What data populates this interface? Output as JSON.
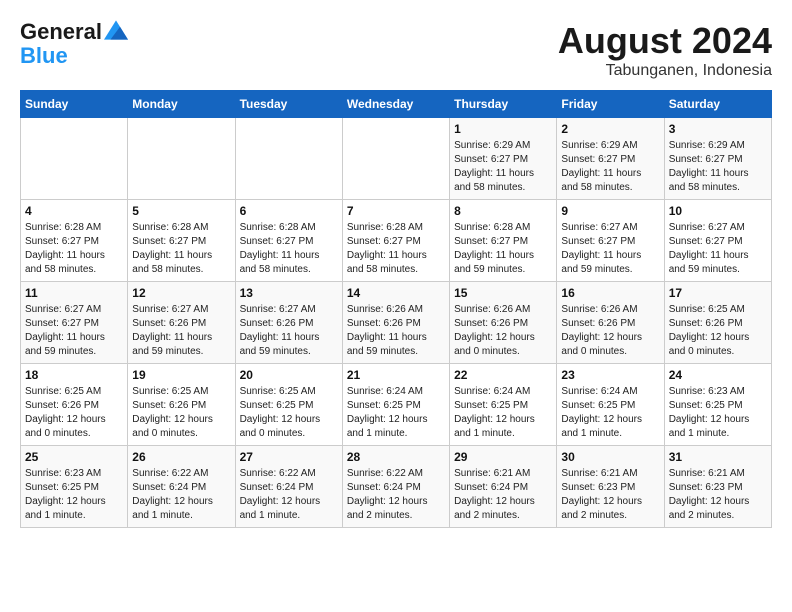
{
  "header": {
    "logo_line1": "General",
    "logo_line2": "Blue",
    "month": "August 2024",
    "location": "Tabunganen, Indonesia"
  },
  "weekdays": [
    "Sunday",
    "Monday",
    "Tuesday",
    "Wednesday",
    "Thursday",
    "Friday",
    "Saturday"
  ],
  "weeks": [
    [
      {
        "day": "",
        "info": ""
      },
      {
        "day": "",
        "info": ""
      },
      {
        "day": "",
        "info": ""
      },
      {
        "day": "",
        "info": ""
      },
      {
        "day": "1",
        "info": "Sunrise: 6:29 AM\nSunset: 6:27 PM\nDaylight: 11 hours\nand 58 minutes."
      },
      {
        "day": "2",
        "info": "Sunrise: 6:29 AM\nSunset: 6:27 PM\nDaylight: 11 hours\nand 58 minutes."
      },
      {
        "day": "3",
        "info": "Sunrise: 6:29 AM\nSunset: 6:27 PM\nDaylight: 11 hours\nand 58 minutes."
      }
    ],
    [
      {
        "day": "4",
        "info": "Sunrise: 6:28 AM\nSunset: 6:27 PM\nDaylight: 11 hours\nand 58 minutes."
      },
      {
        "day": "5",
        "info": "Sunrise: 6:28 AM\nSunset: 6:27 PM\nDaylight: 11 hours\nand 58 minutes."
      },
      {
        "day": "6",
        "info": "Sunrise: 6:28 AM\nSunset: 6:27 PM\nDaylight: 11 hours\nand 58 minutes."
      },
      {
        "day": "7",
        "info": "Sunrise: 6:28 AM\nSunset: 6:27 PM\nDaylight: 11 hours\nand 58 minutes."
      },
      {
        "day": "8",
        "info": "Sunrise: 6:28 AM\nSunset: 6:27 PM\nDaylight: 11 hours\nand 59 minutes."
      },
      {
        "day": "9",
        "info": "Sunrise: 6:27 AM\nSunset: 6:27 PM\nDaylight: 11 hours\nand 59 minutes."
      },
      {
        "day": "10",
        "info": "Sunrise: 6:27 AM\nSunset: 6:27 PM\nDaylight: 11 hours\nand 59 minutes."
      }
    ],
    [
      {
        "day": "11",
        "info": "Sunrise: 6:27 AM\nSunset: 6:27 PM\nDaylight: 11 hours\nand 59 minutes."
      },
      {
        "day": "12",
        "info": "Sunrise: 6:27 AM\nSunset: 6:26 PM\nDaylight: 11 hours\nand 59 minutes."
      },
      {
        "day": "13",
        "info": "Sunrise: 6:27 AM\nSunset: 6:26 PM\nDaylight: 11 hours\nand 59 minutes."
      },
      {
        "day": "14",
        "info": "Sunrise: 6:26 AM\nSunset: 6:26 PM\nDaylight: 11 hours\nand 59 minutes."
      },
      {
        "day": "15",
        "info": "Sunrise: 6:26 AM\nSunset: 6:26 PM\nDaylight: 12 hours\nand 0 minutes."
      },
      {
        "day": "16",
        "info": "Sunrise: 6:26 AM\nSunset: 6:26 PM\nDaylight: 12 hours\nand 0 minutes."
      },
      {
        "day": "17",
        "info": "Sunrise: 6:25 AM\nSunset: 6:26 PM\nDaylight: 12 hours\nand 0 minutes."
      }
    ],
    [
      {
        "day": "18",
        "info": "Sunrise: 6:25 AM\nSunset: 6:26 PM\nDaylight: 12 hours\nand 0 minutes."
      },
      {
        "day": "19",
        "info": "Sunrise: 6:25 AM\nSunset: 6:26 PM\nDaylight: 12 hours\nand 0 minutes."
      },
      {
        "day": "20",
        "info": "Sunrise: 6:25 AM\nSunset: 6:25 PM\nDaylight: 12 hours\nand 0 minutes."
      },
      {
        "day": "21",
        "info": "Sunrise: 6:24 AM\nSunset: 6:25 PM\nDaylight: 12 hours\nand 1 minute."
      },
      {
        "day": "22",
        "info": "Sunrise: 6:24 AM\nSunset: 6:25 PM\nDaylight: 12 hours\nand 1 minute."
      },
      {
        "day": "23",
        "info": "Sunrise: 6:24 AM\nSunset: 6:25 PM\nDaylight: 12 hours\nand 1 minute."
      },
      {
        "day": "24",
        "info": "Sunrise: 6:23 AM\nSunset: 6:25 PM\nDaylight: 12 hours\nand 1 minute."
      }
    ],
    [
      {
        "day": "25",
        "info": "Sunrise: 6:23 AM\nSunset: 6:25 PM\nDaylight: 12 hours\nand 1 minute."
      },
      {
        "day": "26",
        "info": "Sunrise: 6:22 AM\nSunset: 6:24 PM\nDaylight: 12 hours\nand 1 minute."
      },
      {
        "day": "27",
        "info": "Sunrise: 6:22 AM\nSunset: 6:24 PM\nDaylight: 12 hours\nand 1 minute."
      },
      {
        "day": "28",
        "info": "Sunrise: 6:22 AM\nSunset: 6:24 PM\nDaylight: 12 hours\nand 2 minutes."
      },
      {
        "day": "29",
        "info": "Sunrise: 6:21 AM\nSunset: 6:24 PM\nDaylight: 12 hours\nand 2 minutes."
      },
      {
        "day": "30",
        "info": "Sunrise: 6:21 AM\nSunset: 6:23 PM\nDaylight: 12 hours\nand 2 minutes."
      },
      {
        "day": "31",
        "info": "Sunrise: 6:21 AM\nSunset: 6:23 PM\nDaylight: 12 hours\nand 2 minutes."
      }
    ]
  ]
}
